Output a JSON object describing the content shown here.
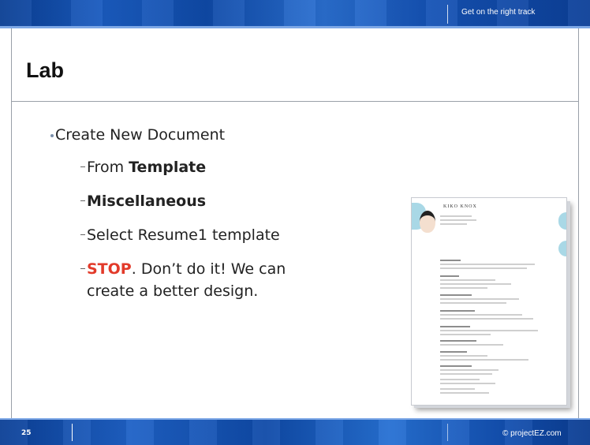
{
  "header": {
    "tagline": "Get on the right track"
  },
  "slide": {
    "title": "Lab",
    "bullet": "Create New Document",
    "subs": {
      "s1_prefix": "From ",
      "s1_bold": "Template",
      "s2_bold": "Miscellaneous",
      "s3": "Select Resume1 template",
      "s4_stop": "STOP",
      "s4_rest": ".  Don’t do it!  We can",
      "s4_line2": "create a better design."
    }
  },
  "thumbnail": {
    "name": "KIKO KNOX"
  },
  "footer": {
    "page_number": "25",
    "copyright": "© projectEZ.com"
  },
  "colors": {
    "banner": "#1553b6",
    "stop": "#e23a2a"
  }
}
